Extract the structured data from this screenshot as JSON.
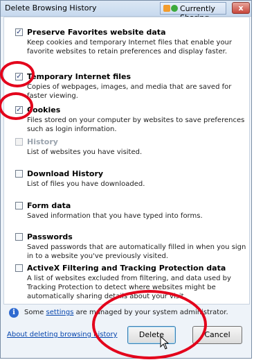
{
  "window": {
    "title": "Delete Browsing History",
    "sharing_label": "Currently Sharing",
    "close_glyph": "x"
  },
  "options": [
    {
      "title": "Preserve Favorites website data",
      "checked": true,
      "disabled": false,
      "description": "Keep cookies and temporary Internet files that enable your favorite websites to retain preferences and display faster."
    },
    {
      "title": "Temporary Internet files",
      "checked": true,
      "disabled": false,
      "description": "Copies of webpages, images, and media that are saved for faster viewing."
    },
    {
      "title": "Cookies",
      "checked": true,
      "disabled": false,
      "description": "Files stored on your computer by websites to save preferences such as login information."
    },
    {
      "title": "History",
      "checked": false,
      "disabled": true,
      "description": "List of websites you have visited."
    },
    {
      "title": "Download History",
      "checked": false,
      "disabled": false,
      "description": "List of files you have downloaded."
    },
    {
      "title": "Form data",
      "checked": false,
      "disabled": false,
      "description": "Saved information that you have typed into forms."
    },
    {
      "title": "Passwords",
      "checked": false,
      "disabled": false,
      "description": "Saved passwords that are automatically filled in when you sign in to a website you've previously visited."
    },
    {
      "title": "ActiveX Filtering and Tracking Protection data",
      "checked": false,
      "disabled": false,
      "description": "A list of websites excluded from filtering, and data used by Tracking Protection to detect where websites might be automatically sharing details about your visit."
    }
  ],
  "info": {
    "prefix": "Some ",
    "link": "settings",
    "suffix": " are managed by your system administrator."
  },
  "footer": {
    "about_link": "About deleting browsing history",
    "delete_label": "Delete",
    "cancel_label": "Cancel"
  },
  "colors": {
    "annotation_ring": "#e3001b",
    "link": "#0645ad",
    "info_icon": "#2f6ad0"
  },
  "icons": {
    "info": "info-icon",
    "sharing": "sharing-icon",
    "cursor": "mouse-pointer-icon"
  }
}
